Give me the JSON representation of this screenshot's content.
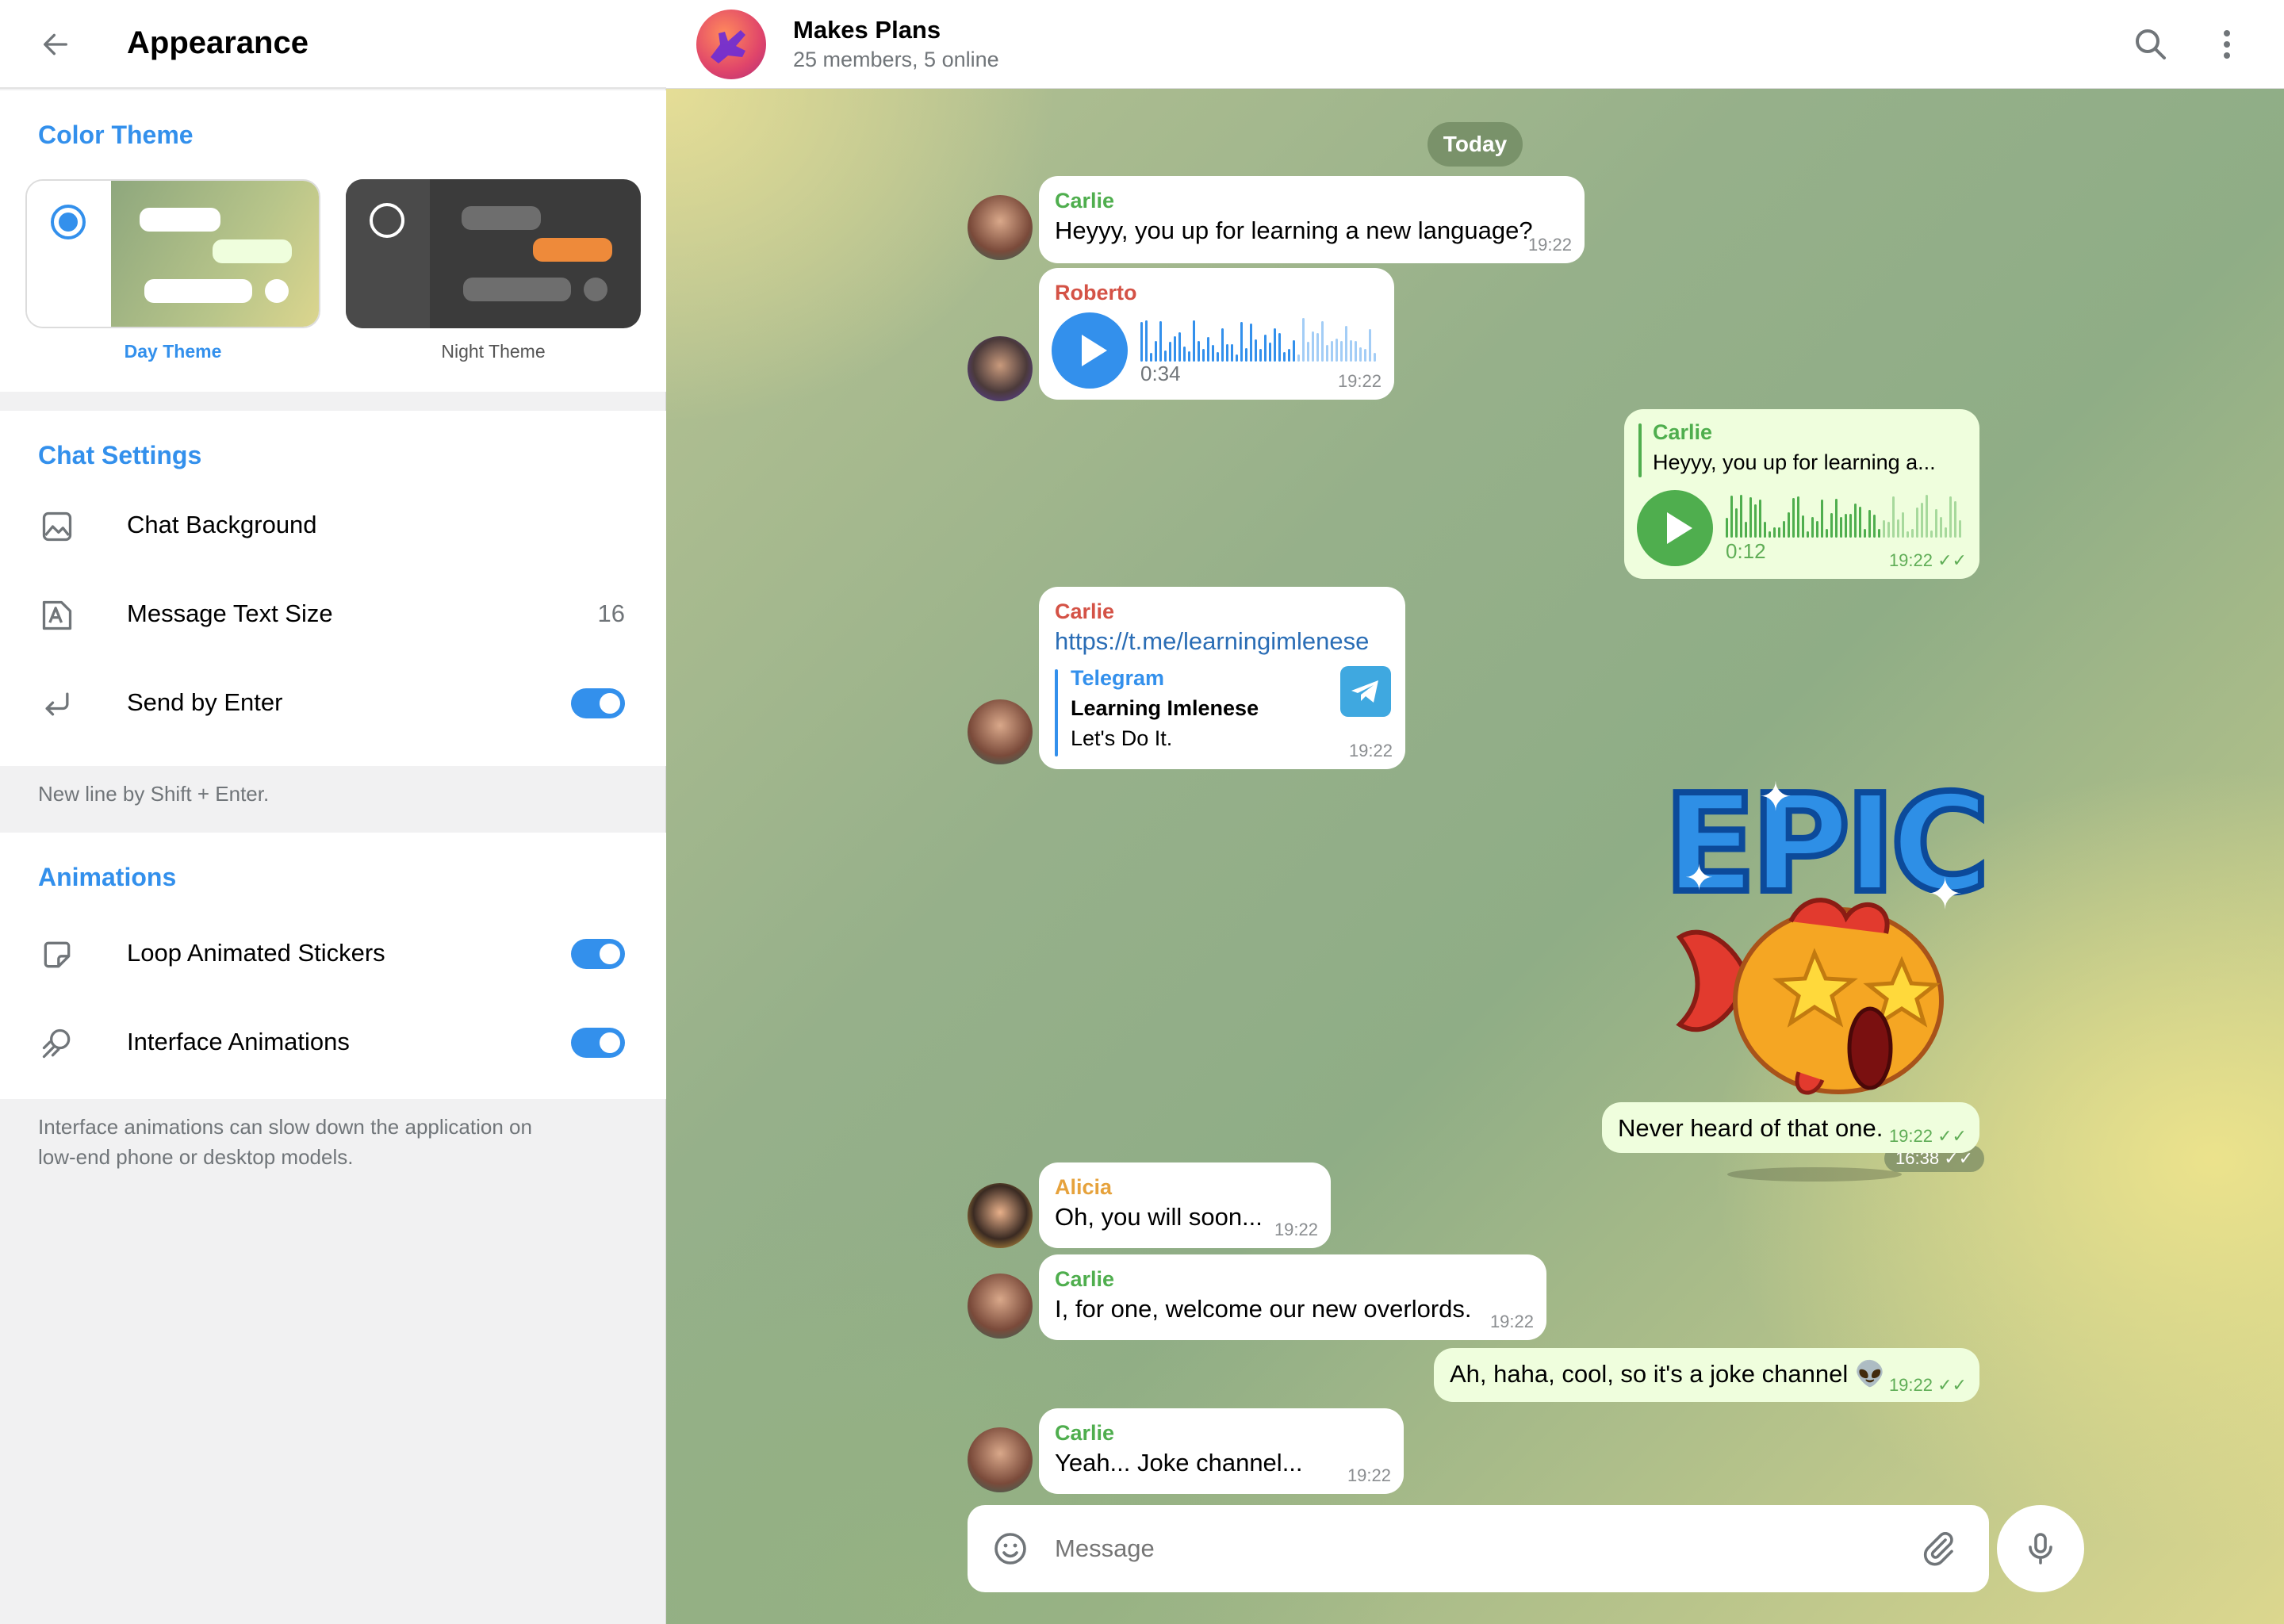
{
  "left_panel": {
    "title": "Appearance",
    "color_theme": {
      "section_title": "Color Theme",
      "day_label": "Day Theme",
      "night_label": "Night Theme"
    },
    "chat_settings": {
      "section_title": "Chat Settings",
      "background_label": "Chat Background",
      "text_size_label": "Message Text Size",
      "text_size_value": "16",
      "send_enter_label": "Send by Enter",
      "hint": "New line by Shift + Enter."
    },
    "animations": {
      "section_title": "Animations",
      "loop_label": "Loop Animated Stickers",
      "interface_label": "Interface Animations",
      "hint_line1": "Interface animations can slow down the application on",
      "hint_line2": "low-end phone or desktop models."
    }
  },
  "chat": {
    "name": "Makes Plans",
    "subtitle": "25 members, 5 online",
    "date_pill": "Today",
    "composer_placeholder": "Message",
    "messages": [
      {
        "sender": "Carlie",
        "text": "Heyyy, you up for learning a new language?",
        "time": "19:22"
      },
      {
        "sender": "Roberto",
        "duration": "0:34",
        "time": "19:22"
      },
      {
        "reply_sender": "Carlie",
        "reply_text": "Heyyy, you up for learning a...",
        "duration": "0:12",
        "time": "19:22"
      },
      {
        "sender": "Carlie",
        "link": "https://t.me/learningimlenese",
        "preview_site": "Telegram",
        "preview_title": "Learning Imlenese",
        "preview_desc": "Let's Do It.",
        "time": "19:22"
      },
      {
        "sticker_text": "EPIC",
        "time": "16:38"
      },
      {
        "text": "Never heard of that one.",
        "time": "19:22"
      },
      {
        "sender": "Alicia",
        "text": "Oh, you will soon...",
        "time": "19:22"
      },
      {
        "sender": "Carlie",
        "text": "I, for one, welcome our new overlords.",
        "time": "19:22"
      },
      {
        "text": "Ah, haha, cool, so it's a joke channel 👽",
        "time": "19:22"
      },
      {
        "sender": "Carlie",
        "text": "Yeah... Joke channel...",
        "time": "19:22"
      }
    ]
  },
  "colors": {
    "accent": "#3390ec",
    "carlie": "#4fae4e",
    "roberto": "#d45246",
    "alicia": "#e6a23c",
    "outgoing_bubble": "#effedd"
  }
}
